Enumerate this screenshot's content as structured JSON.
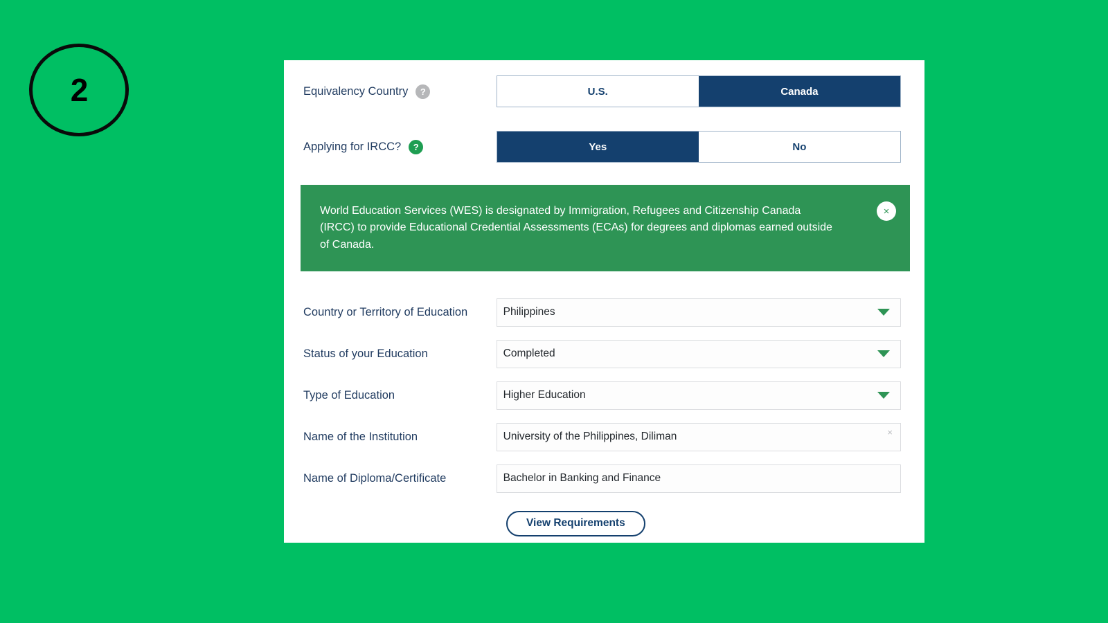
{
  "colors": {
    "page_background": "#00BF63",
    "card_background": "#FFFFFF",
    "navy": "#14406E",
    "banner_green": "#2E9455",
    "accent_green": "#1E9E52",
    "label_navy": "#1F3A5F",
    "help_gray": "#B6B7B9"
  },
  "step_badge": {
    "number": "2"
  },
  "toggles": [
    {
      "label": "Equivalency Country",
      "help_icon": "question-mark-icon",
      "help_icon_state": "inactive",
      "options": [
        "U.S.",
        "Canada"
      ],
      "selected": "Canada"
    },
    {
      "label": "Applying for IRCC?",
      "help_icon": "question-mark-icon",
      "help_icon_state": "active",
      "options": [
        "Yes",
        "No"
      ],
      "selected": "Yes"
    }
  ],
  "banner": {
    "text": "World Education Services (WES) is designated by Immigration, Refugees and Citizenship Canada (IRCC) to provide Educational Credential Assessments (ECAs) for degrees and diplomas earned outside of Canada.",
    "close_icon": "close-icon",
    "close_label": "×"
  },
  "fields": [
    {
      "label": "Country or Territory of Education",
      "value": "Philippines",
      "control": "dropdown",
      "icon": "chevron-down-icon"
    },
    {
      "label": "Status of your Education",
      "value": "Completed",
      "control": "dropdown",
      "icon": "chevron-down-icon"
    },
    {
      "label": "Type of Education",
      "value": "Higher Education",
      "control": "dropdown",
      "icon": "chevron-down-icon"
    },
    {
      "label": "Name of the Institution",
      "value": "University of the Philippines, Diliman",
      "control": "text",
      "icon": "clear-icon",
      "icon_label": "×"
    },
    {
      "label": "Name of Diploma/Certificate",
      "value": "Bachelor in Banking and Finance",
      "control": "text",
      "icon": "none"
    }
  ],
  "actions": {
    "view_requirements_label": "View Requirements"
  }
}
